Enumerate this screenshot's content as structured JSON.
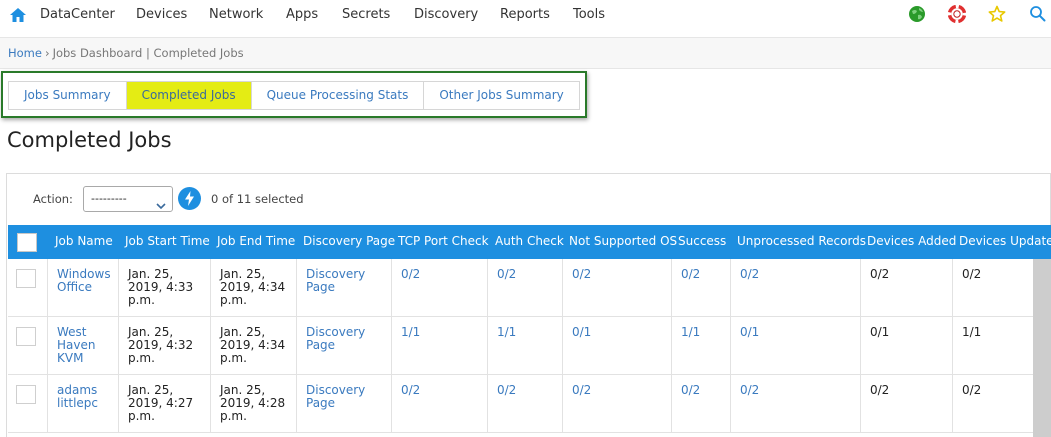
{
  "nav": {
    "items": [
      "DataCenter",
      "Devices",
      "Network",
      "Apps",
      "Secrets",
      "Discovery",
      "Reports",
      "Tools"
    ],
    "icons": [
      "home-icon",
      "globe-icon",
      "lifebuoy-icon",
      "star-icon",
      "search-icon"
    ],
    "colors": {
      "home": "#1e8fe0",
      "globe": "#2a9a2a",
      "lifebuoy": "#e03030",
      "star": "#e8c800",
      "search": "#1e8fe0"
    }
  },
  "breadcrumb": {
    "home": "Home",
    "sep": "›",
    "trail": "Jobs Dashboard | Completed Jobs"
  },
  "tabs": [
    {
      "label": "Jobs Summary",
      "active": false
    },
    {
      "label": "Completed Jobs",
      "active": true
    },
    {
      "label": "Queue Processing Stats",
      "active": false
    },
    {
      "label": "Other Jobs Summary",
      "active": false
    }
  ],
  "page_title": "Completed Jobs",
  "action": {
    "label": "Action:",
    "selected": "---------",
    "selection_status": "0 of 11 selected"
  },
  "table": {
    "columns": [
      "Job Name",
      "Job Start Time",
      "Job End Time",
      "Discovery Page",
      "TCP Port Check",
      "Auth Check",
      "Not Supported OS",
      "Success",
      "Unprocessed Records",
      "Devices Added",
      "Devices Updated"
    ],
    "rows": [
      {
        "job_name": [
          "Windows",
          "Office"
        ],
        "start": [
          "Jan. 25,",
          "2019, 4:33",
          "p.m."
        ],
        "end": [
          "Jan. 25,",
          "2019, 4:34",
          "p.m."
        ],
        "discovery_page": [
          "Discovery",
          "Page"
        ],
        "tcp": "0/2",
        "auth": "0/2",
        "not_supported": "0/2",
        "success": "0/2",
        "unprocessed": "0/2",
        "added": "0/2",
        "updated": "0/2"
      },
      {
        "job_name": [
          "West",
          "Haven",
          "KVM"
        ],
        "start": [
          "Jan. 25,",
          "2019, 4:32",
          "p.m."
        ],
        "end": [
          "Jan. 25,",
          "2019, 4:34",
          "p.m."
        ],
        "discovery_page": [
          "Discovery",
          "Page"
        ],
        "tcp": "1/1",
        "auth": "1/1",
        "not_supported": "0/1",
        "success": "1/1",
        "unprocessed": "0/1",
        "added": "0/1",
        "updated": "1/1"
      },
      {
        "job_name": [
          "adams",
          "littlepc"
        ],
        "start": [
          "Jan. 25,",
          "2019, 4:27",
          "p.m."
        ],
        "end": [
          "Jan. 25,",
          "2019, 4:28",
          "p.m."
        ],
        "discovery_page": [
          "Discovery",
          "Page"
        ],
        "tcp": "0/2",
        "auth": "0/2",
        "not_supported": "0/2",
        "success": "0/2",
        "unprocessed": "0/2",
        "added": "0/2",
        "updated": "0/2"
      }
    ]
  },
  "colors": {
    "accent": "#1e8fe0",
    "active_tab": "#e4ec14",
    "highlight_border": "#2a7a2a",
    "link": "#3a7abf"
  }
}
